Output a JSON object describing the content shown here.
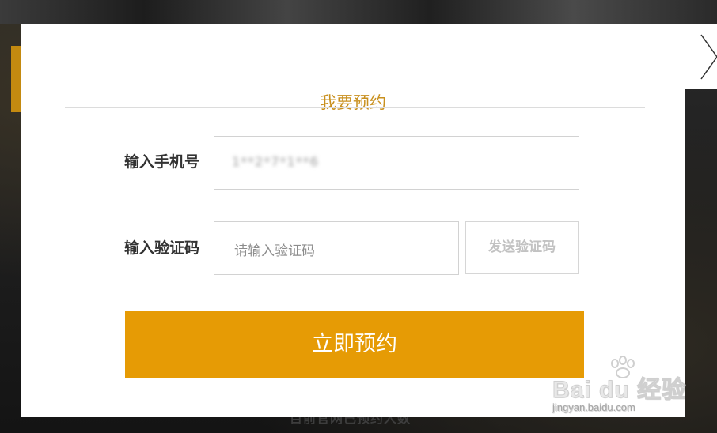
{
  "dialog": {
    "title": "我要预约",
    "phone": {
      "label": "输入手机号",
      "value": "1**2*7*1**6"
    },
    "code": {
      "label": "输入验证码",
      "placeholder": "请输入验证码",
      "send_button": "发送验证码"
    },
    "submit_button": "立即预约"
  },
  "backdrop": {
    "caption": "目前官网已预约人数"
  },
  "watermark": {
    "brand": "Bai du 经验",
    "url": "jingyan.baidu.com"
  },
  "colors": {
    "accent": "#e69b05",
    "title": "#c9901e"
  },
  "icons": {
    "close": "chevron-right-icon",
    "watermark": "paw-icon"
  }
}
